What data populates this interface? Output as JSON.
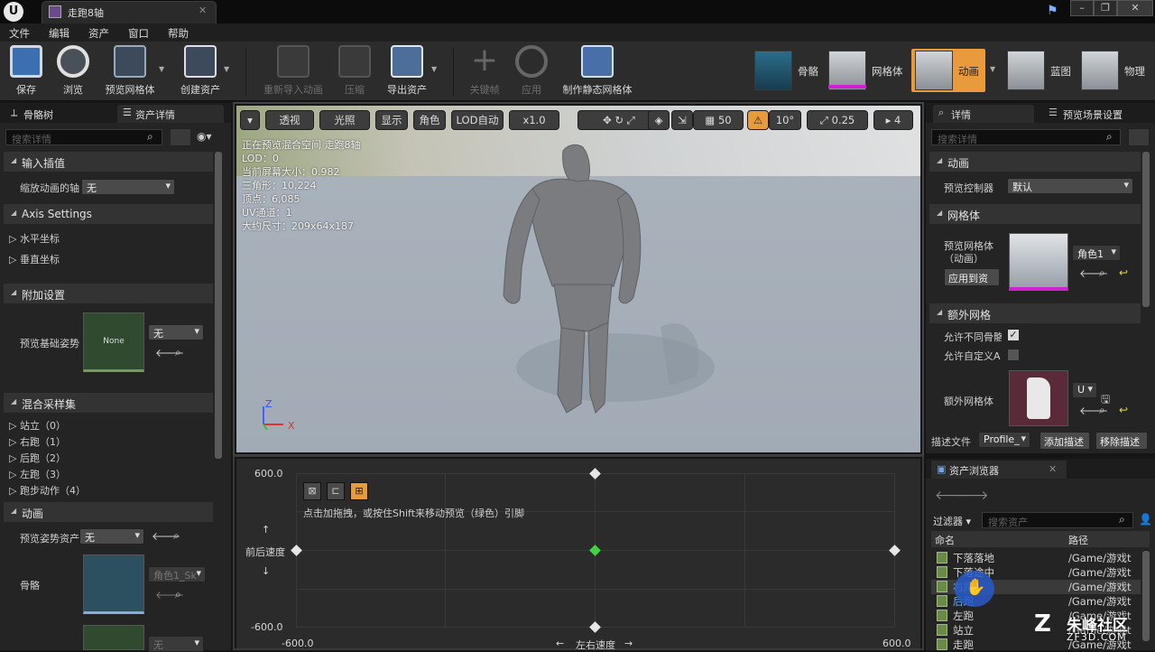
{
  "window": {
    "tab_title": "走跑8轴",
    "minimize": "–",
    "restore": "❐",
    "close": "✕"
  },
  "menu": [
    "文件",
    "编辑",
    "资产",
    "窗口",
    "帮助"
  ],
  "toolbar": {
    "save": "保存",
    "browse": "浏览",
    "preview_mesh": "预览网格体",
    "create_asset": "创建资产",
    "reimport": "重新导入动画",
    "compress": "压缩",
    "export": "导出资产",
    "keyframe": "关键帧",
    "apply": "应用",
    "make_static_mesh": "制作静态网格体"
  },
  "modes": [
    "骨骼",
    "网格体",
    "动画",
    "蓝图",
    "物理"
  ],
  "left_panel": {
    "tabs": [
      "骨骼树",
      "资产详情"
    ],
    "search_placeholder": "搜索详情",
    "sections": {
      "input_interp": "输入插值",
      "scale_label": "缩放动画的轴",
      "scale_value": "无",
      "axis_settings": "Axis Settings",
      "horizontal": "水平坐标",
      "vertical": "垂直坐标",
      "additive": "附加设置",
      "preview_base_pose": "预览基础姿势",
      "base_pose_thumb": "None",
      "base_pose_value": "无",
      "blend_samples": "混合采样集",
      "samples": [
        "站立（0）",
        "右跑（1）",
        "后跑（2）",
        "左跑（3）",
        "跑步动作（4）"
      ],
      "animation": "动画",
      "preview_pose_asset": "预览姿势资产",
      "preview_pose_value": "无",
      "skeleton": "骨骼",
      "skeleton_value": "角色1_Sk",
      "bottom_value": "无"
    }
  },
  "viewport": {
    "toolbar": {
      "perspective": "透视",
      "lit": "光照",
      "show": "显示",
      "character": "角色",
      "lod": "LOD自动",
      "speed": "x1.0",
      "grid_size": "50",
      "rot_snap": "10°",
      "scale_snap": "0.25",
      "camera_speed": "4"
    },
    "stats": [
      "正在预览混合空间 走跑8轴",
      "LOD：0",
      "当前屏幕大小：0.982",
      "三角形：10,224",
      "顶点：6,085",
      "UV通道：1",
      "大约尺寸：209x64x187"
    ],
    "axis_x": "X",
    "axis_z": "Z"
  },
  "graph": {
    "hint": "点击加拖拽，或按住Shift来移动预览（绿色）引脚",
    "y_max": "600.0",
    "y_min": "-600.0",
    "x_min": "-600.0",
    "x_max": "600.0",
    "y_label": "前后速度",
    "x_label": "左右速度",
    "arrow_up": "↑",
    "arrow_down": "↓",
    "arrow_left": "←",
    "arrow_right": "→"
  },
  "right_panel": {
    "tabs": [
      "详情",
      "预览场景设置"
    ],
    "search_placeholder": "搜索详情",
    "animation_section": "动画",
    "preview_controller_label": "预览控制器",
    "preview_controller_value": "默认",
    "mesh_section": "网格体",
    "preview_mesh_label": "预览网格体（动画）",
    "mesh_value": "角色1",
    "apply_to_asset": "应用到资",
    "extra_mesh_section": "额外网格",
    "allow_diff_skel": "允许不同骨骼",
    "allow_custom": "允许自定义A",
    "extra_mesh_label": "额外网格体",
    "extra_mesh_value": "U",
    "profile_label": "描述文件",
    "profile_value": "Profile_",
    "add_profile": "添加描述",
    "remove_profile": "移除描述"
  },
  "asset_browser": {
    "title": "资产浏览器",
    "filters": "过滤器",
    "search_placeholder": "搜索资产",
    "col_name": "命名",
    "col_path": "路径",
    "rows": [
      {
        "name": "下落落地",
        "path": "/Game/游戏t"
      },
      {
        "name": "下落途中",
        "path": "/Game/游戏t"
      },
      {
        "name": "右跑",
        "path": "/Game/游戏t"
      },
      {
        "name": "后跑",
        "path": "/Game/游戏t"
      },
      {
        "name": "左跑",
        "path": "/Game/游戏t"
      },
      {
        "name": "站立",
        "path": "/Game/游戏t"
      },
      {
        "name": "走跑",
        "path": "/Game/游戏t"
      }
    ]
  },
  "watermark": {
    "brand": "朱峰社区",
    "url": "ZF3D.COM"
  },
  "colors": {
    "accent_orange": "#e89a3c",
    "pin_green": "#3fd43f",
    "magenta_bar": "#d020d0"
  }
}
